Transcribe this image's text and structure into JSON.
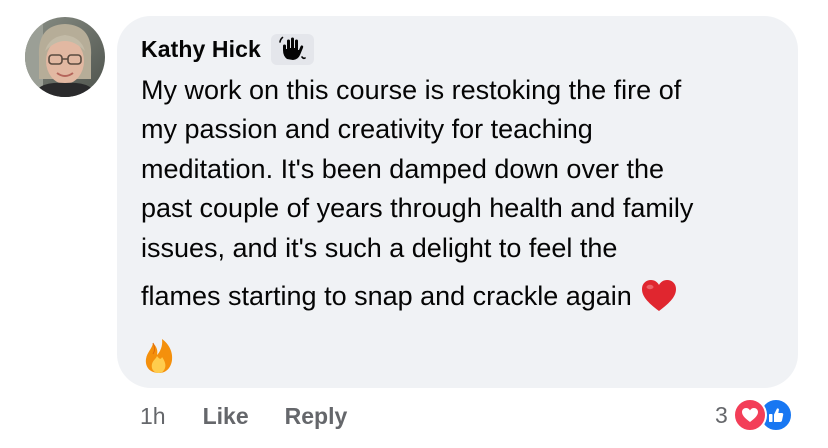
{
  "comment": {
    "author": "Kathy Hick",
    "badge_icon": "waving-hand-icon",
    "text_lines": [
      "My work on this course is restoking the fire of",
      "my passion and creativity for teaching",
      "meditation. It's been damped down over the",
      "past couple of years through health and family",
      "issues, and it's such a delight to feel the",
      "flames starting to snap and crackle again"
    ],
    "inline_emoji": "red-heart-icon",
    "trailing_emoji": "fire-icon"
  },
  "actions": {
    "timestamp": "1h",
    "like_label": "Like",
    "reply_label": "Reply"
  },
  "reactions": {
    "count": "3",
    "icons": [
      "love-reaction-icon",
      "like-reaction-icon"
    ],
    "love_color": "#f33e58",
    "like_color": "#1877f2"
  },
  "colors": {
    "bubble": "#f0f2f5",
    "text": "#050505",
    "secondary": "#65676b"
  }
}
